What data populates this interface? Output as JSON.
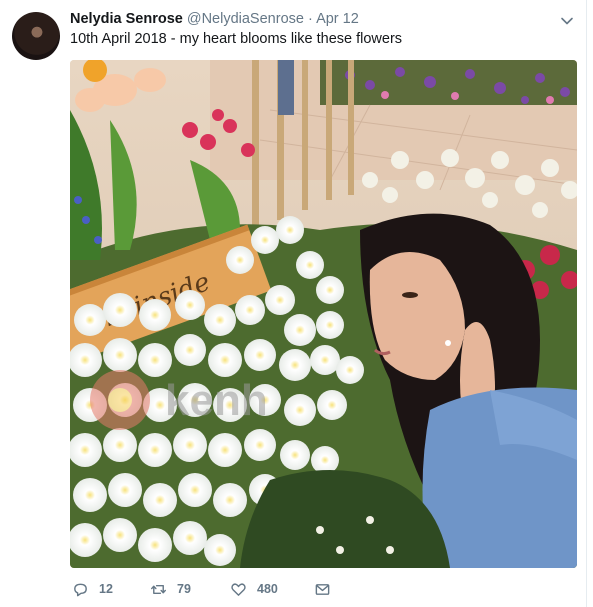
{
  "tweet": {
    "name": "Nelydia Senrose",
    "handle": "@NelydiaSenrose",
    "separator": "·",
    "date": "Apr 12",
    "text": "10th April 2018 - my heart blooms like these flowers"
  },
  "photo": {
    "sign_text": "the inside",
    "watermark": "kenh"
  },
  "actions": {
    "reply_count": "12",
    "retweet_count": "79",
    "like_count": "480"
  },
  "icons": {
    "reply": "reply-icon",
    "retweet": "retweet-icon",
    "like": "heart-icon",
    "message": "envelope-icon",
    "menu": "chevron-down-icon"
  },
  "colors": {
    "text": "#14171a",
    "secondary": "#657786",
    "divider": "#e6ecf0"
  }
}
